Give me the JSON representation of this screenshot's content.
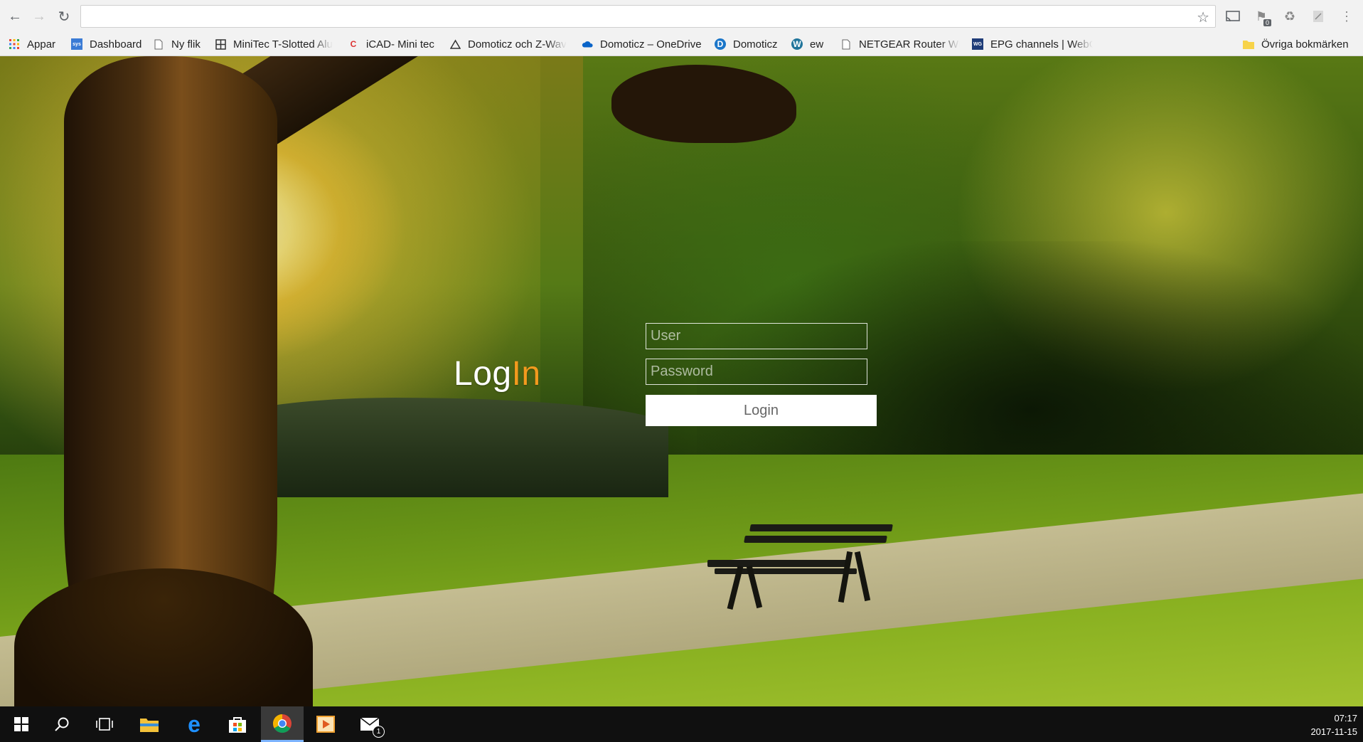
{
  "browser": {
    "address": {
      "value": "",
      "placeholder": ""
    },
    "bookmarks": [
      {
        "label": "Appar",
        "icon": "apps-grid-icon"
      },
      {
        "label": "Dashboard",
        "icon": "dashboard-favicon"
      },
      {
        "label": "Ny flik",
        "icon": "page-icon"
      },
      {
        "label": "MiniTec T-Slotted Alu",
        "icon": "minitec-favicon"
      },
      {
        "label": "iCAD- Mini tec",
        "icon": "icad-favicon"
      },
      {
        "label": "Domoticz och Z-Wav",
        "icon": "domoticz-favicon"
      },
      {
        "label": "Domoticz – OneDrive",
        "icon": "onedrive-cloud-icon"
      },
      {
        "label": "Domoticz",
        "icon": "domoticz-favicon"
      },
      {
        "label": "ew",
        "icon": "wordpress-icon"
      },
      {
        "label": "NETGEAR Router WN",
        "icon": "page-icon"
      },
      {
        "label": "EPG channels | WebG",
        "icon": "webgrab-favicon"
      },
      {
        "label": "Övriga bokmärken",
        "icon": "folder-icon"
      }
    ],
    "extensions": {
      "badge_count": "0"
    }
  },
  "login": {
    "title_main": "Log",
    "title_accent": "In",
    "user_placeholder": "User",
    "password_placeholder": "Password",
    "button_label": "Login",
    "accent_color": "#f39a1e"
  },
  "taskbar": {
    "mail_badge": "1",
    "time": "07:17",
    "date": "2017-11-15"
  }
}
